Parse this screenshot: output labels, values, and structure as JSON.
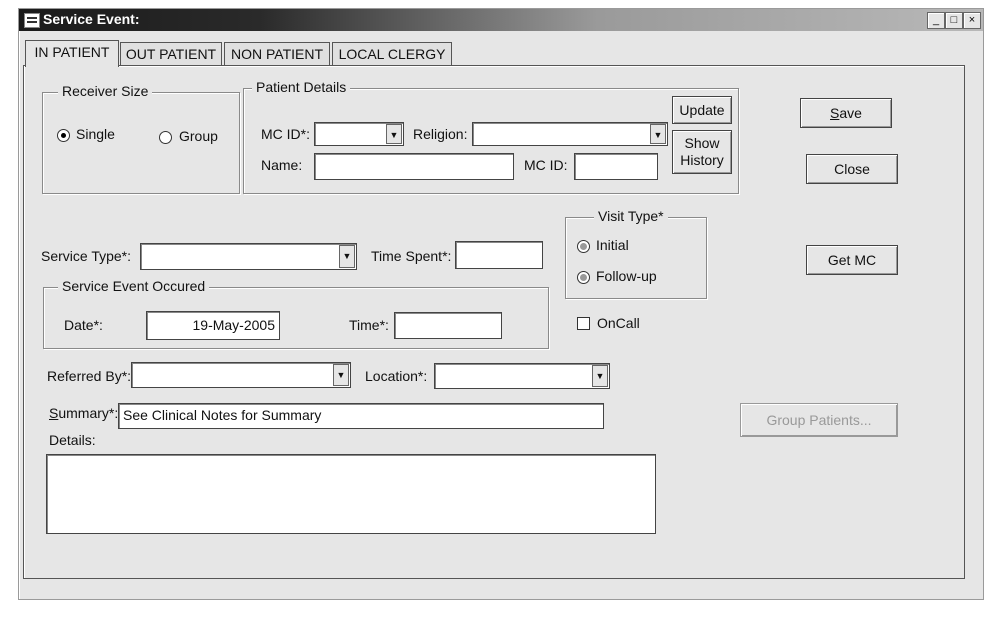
{
  "window": {
    "title": "Service Event:",
    "minimize": "_",
    "maximize": "□",
    "close": "×"
  },
  "tabs": [
    {
      "label": "IN PATIENT",
      "active": true
    },
    {
      "label": "OUT PATIENT"
    },
    {
      "label": "NON PATIENT"
    },
    {
      "label": "LOCAL CLERGY"
    }
  ],
  "receiver_size": {
    "legend": "Receiver Size",
    "single": "Single",
    "group": "Group",
    "selected": "Single"
  },
  "patient_details": {
    "legend": "Patient Details",
    "mc_id_label": "MC ID*:",
    "mc_id_value": "",
    "religion_label": "Religion:",
    "religion_value": "",
    "name_label": "Name:",
    "name_value": "",
    "mc_id2_label": "MC ID:",
    "mc_id2_value": "",
    "update_button": "Update",
    "show_history_button_line1": "Show",
    "show_history_button_line2": "History"
  },
  "service_type": {
    "label": "Service Type*:",
    "value": ""
  },
  "time_spent": {
    "label": "Time Spent*:",
    "value": ""
  },
  "visit_type": {
    "legend": "Visit Type*",
    "initial": "Initial",
    "follow_up": "Follow-up"
  },
  "service_event_occured": {
    "legend": "Service Event Occured",
    "date_label": "Date*:",
    "date_value": "19-May-2005",
    "time_label": "Time*:",
    "time_value": ""
  },
  "oncall": {
    "label": "OnCall",
    "checked": false
  },
  "referred_by": {
    "label": "Referred By*:",
    "value": ""
  },
  "location": {
    "label": "Location*:",
    "value": ""
  },
  "summary": {
    "label_rest": "ummary*:",
    "label_underline": "S",
    "value": "See Clinical Notes for Summary"
  },
  "details": {
    "label": "Details:",
    "value": ""
  },
  "buttons": {
    "save_underline": "S",
    "save_rest": "ave",
    "close": "Close",
    "get_mc": "Get MC",
    "group_patients": "Group Patients..."
  }
}
